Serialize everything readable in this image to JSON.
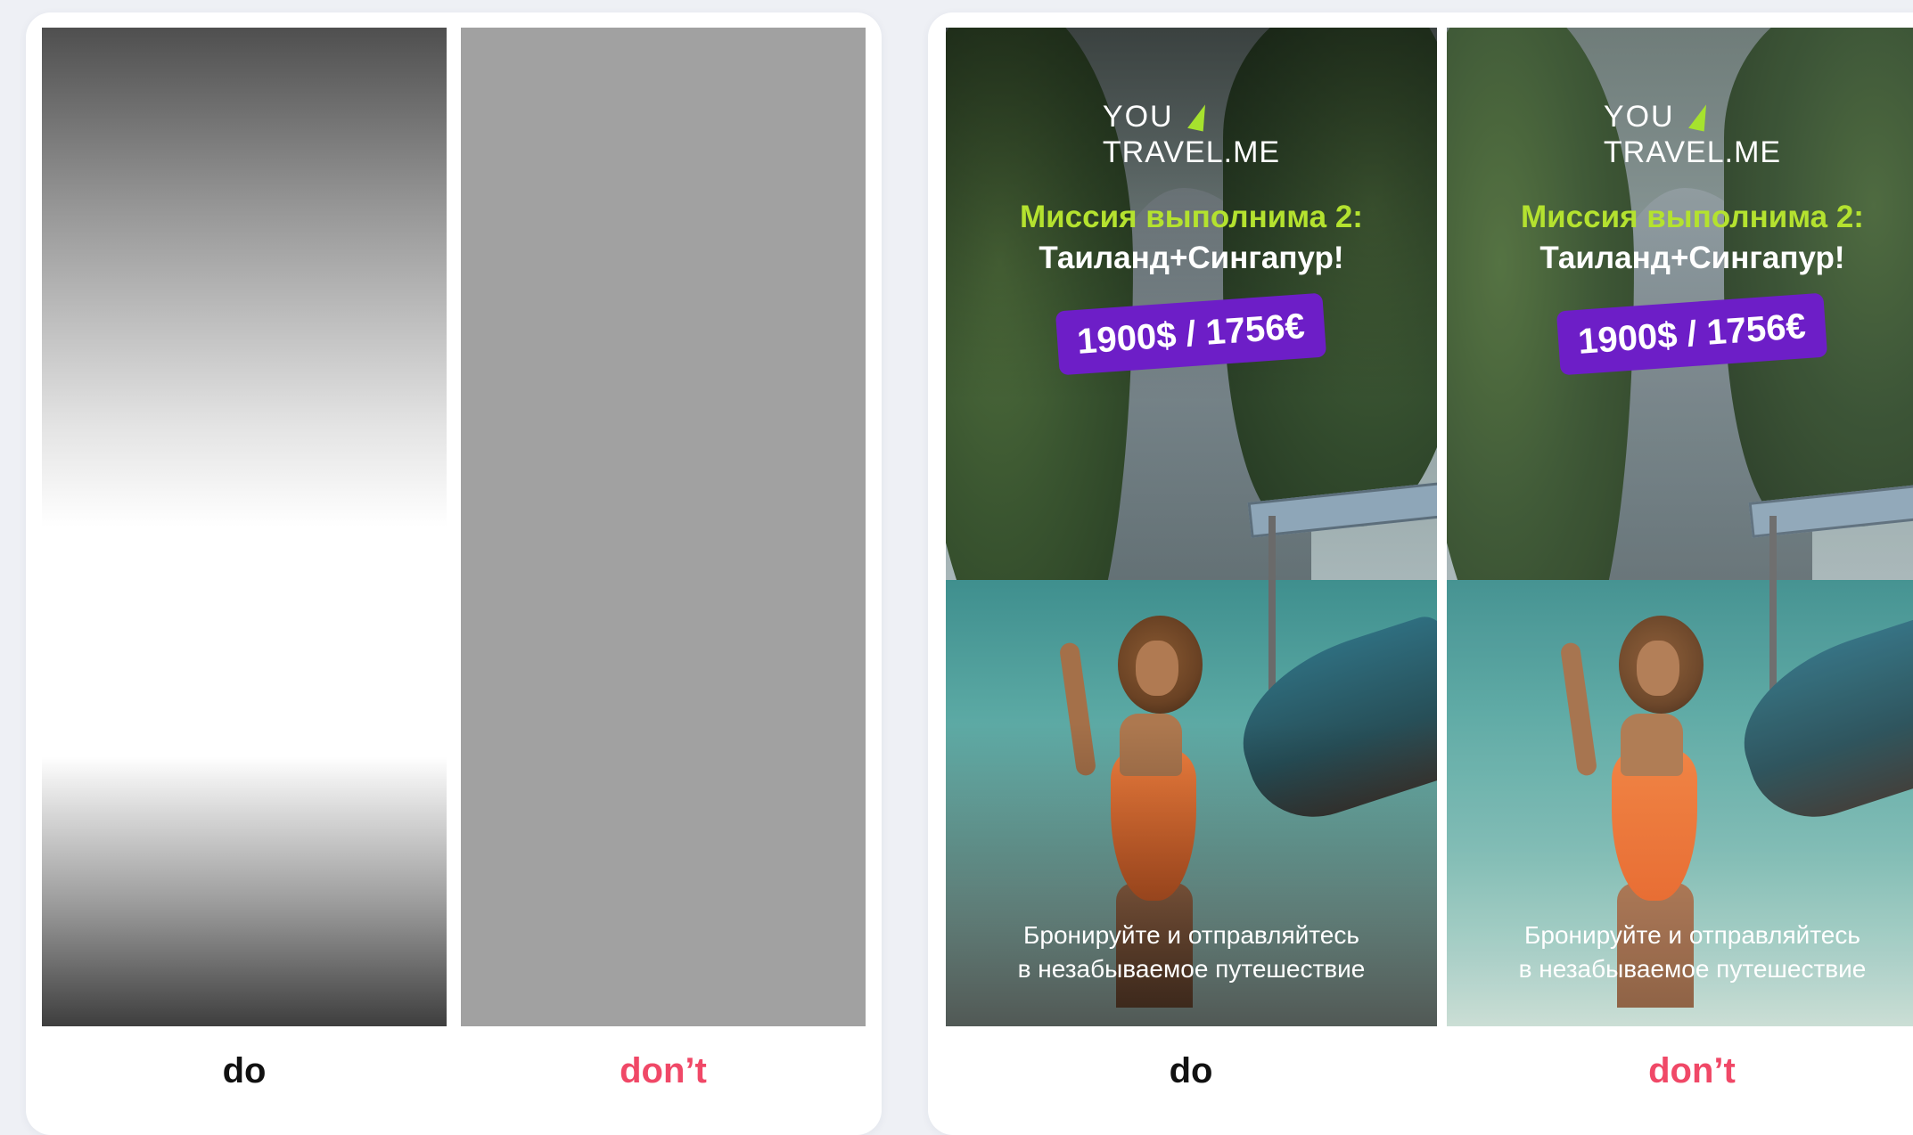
{
  "examples": [
    {
      "do_label": "do",
      "dont_label": "don’t"
    },
    {
      "do_label": "do",
      "dont_label": "don’t",
      "ad": {
        "logo_top": "YOU",
        "logo_bottom": "TRAVEL.ME",
        "headline_line1": "Миссия выполнима 2:",
        "headline_line2": "Таиланд+Сингапур!",
        "price": "1900$ / 1756€",
        "bottom_line1": "Бронируйте и отправляйтесь",
        "bottom_line2": "в незабываемое путешествие"
      }
    }
  ],
  "colors": {
    "background": "#eef0f5",
    "card": "#ffffff",
    "do_text": "#111111",
    "dont_text": "#f04867",
    "headline_accent": "#b4e22f",
    "price_badge": "#6d1ec7",
    "logo_arrow": "#a6e22e"
  }
}
